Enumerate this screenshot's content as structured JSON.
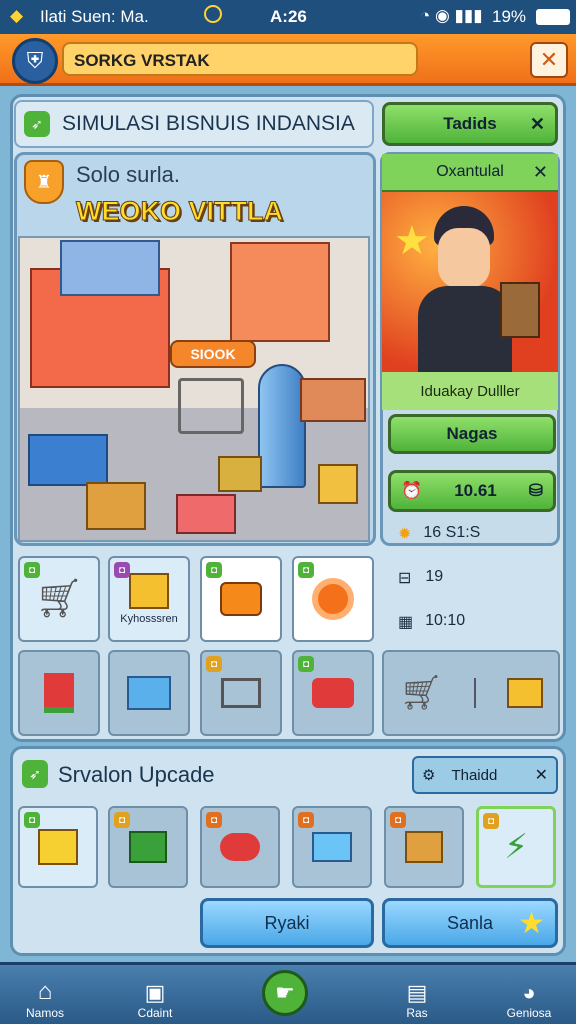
{
  "status": {
    "app": "Ilati Suen: Ma.",
    "time": "A:26",
    "battery": "19%"
  },
  "header": {
    "title": "SORKG VRSTAK"
  },
  "main": {
    "title": "SIMULASI BISNUIS INDANSIA",
    "tab_button": "Tadids",
    "store": {
      "subtitle": "Solo surla.",
      "name": "WEOKO VITTLA",
      "sign": "SIOOK"
    }
  },
  "profile": {
    "header": "Oxantulal",
    "name": "Iduakay Dulller",
    "action_button": "Nagas",
    "money": "10.61",
    "stat1": "16 S1:S",
    "stat2": "19",
    "stat3": "10:10"
  },
  "items": {
    "caption": "Kyhosssren"
  },
  "upgrade": {
    "title": "Srvalon Upcade",
    "tab": "Thaidd"
  },
  "buttons": {
    "left": "Ryaki",
    "right": "Sanla"
  },
  "nav": [
    {
      "label": "Namos"
    },
    {
      "label": "Cdaint"
    },
    {
      "label": ""
    },
    {
      "label": "Ras"
    },
    {
      "label": "Geniosa"
    }
  ],
  "colors": {
    "orange": "#f47c20",
    "green": "#5cc43e",
    "blue": "#4aa8e8"
  }
}
